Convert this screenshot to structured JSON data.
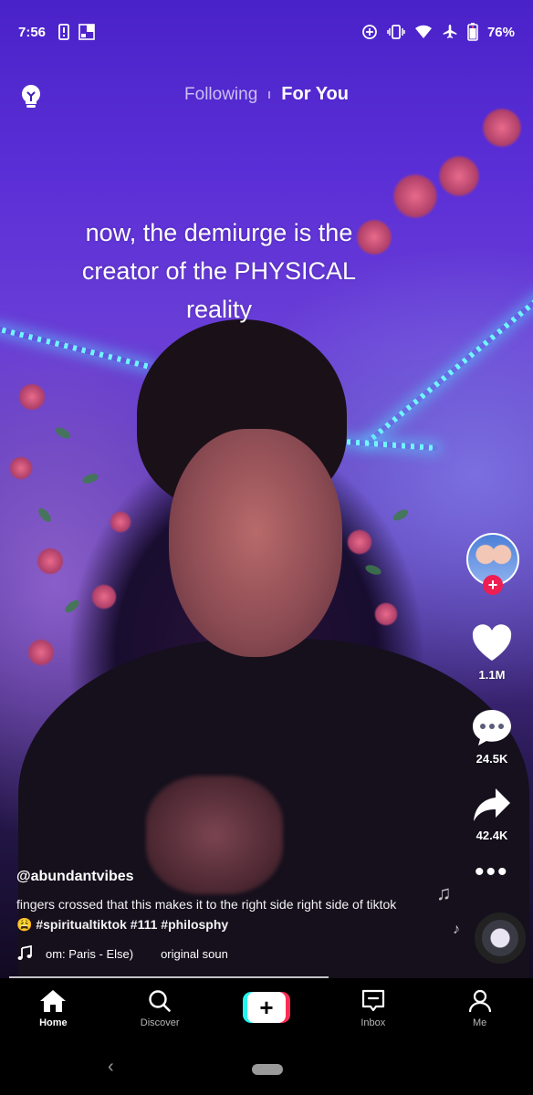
{
  "status_bar": {
    "time": "7:56",
    "battery": "76%",
    "left_icons": [
      "sim-alert-icon",
      "news-icon"
    ],
    "right_icons": [
      "data-saver-icon",
      "vibrate-icon",
      "wifi-icon",
      "airplane-icon",
      "battery-icon"
    ]
  },
  "top_nav": {
    "following_label": "Following",
    "for_you_label": "For You"
  },
  "video": {
    "caption_lines": [
      "now, the demiurge is the",
      "creator of the PHYSICAL",
      "reality"
    ]
  },
  "rail": {
    "like_count": "1.1M",
    "comment_count": "24.5K",
    "share_count": "42.4K",
    "follow_symbol": "+"
  },
  "post": {
    "username": "@abundantvibes",
    "description": "fingers crossed that this makes it to the right side right side of tiktok",
    "emoji": "😩",
    "hashtags": "#spiritualtiktok #111 #philosphy",
    "sound_title": "om: Paris - Else)",
    "sound_original": "original soun"
  },
  "tab_bar": {
    "home": "Home",
    "discover": "Discover",
    "create_symbol": "+",
    "inbox": "Inbox",
    "me": "Me"
  },
  "colors": {
    "accent_red": "#fe2c55",
    "accent_cyan": "#25f4ee"
  }
}
